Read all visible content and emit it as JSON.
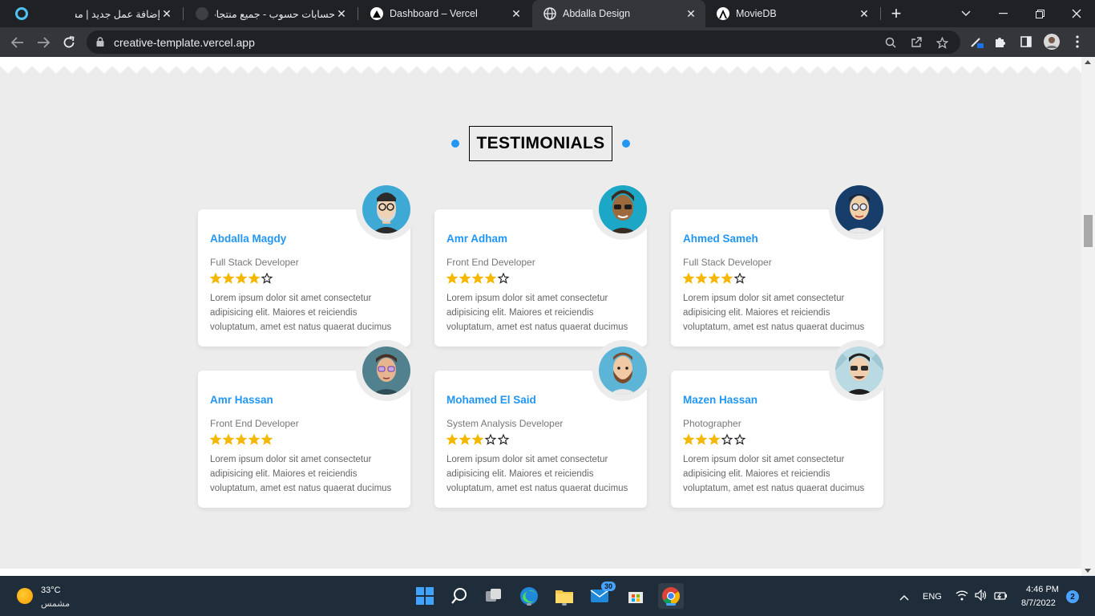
{
  "browser": {
    "tabs": [
      {
        "title": "إضافة عمل جديد | مستقل",
        "icon": "mostaql-icon"
      },
      {
        "title": "حسابات حسوب - جميع منتجات",
        "icon": "hsoub-icon"
      },
      {
        "title": "Dashboard – Vercel",
        "icon": "vercel-icon"
      },
      {
        "title": "Abdalla Design",
        "icon": "globe-icon",
        "active": true
      },
      {
        "title": "MovieDB",
        "icon": "angular-icon"
      }
    ],
    "url": "creative-template.vercel.app"
  },
  "testimonials": {
    "title": "TESTIMONIALS",
    "accent": "#2196f3",
    "star_color": "#f5b800",
    "items": [
      {
        "name": "Abdalla Magdy",
        "role": "Full Stack Developer",
        "rating": 4,
        "text": "Lorem ipsum dolor sit amet consectetur adipisicing elit. Maiores et reiciendis voluptatum, amet est natus quaerat ducimus",
        "avatar": "avatar-glasses-beard"
      },
      {
        "name": "Amr Adham",
        "role": "Front End Developer",
        "rating": 4,
        "text": "Lorem ipsum dolor sit amet consectetur adipisicing elit. Maiores et reiciendis voluptatum, amet est natus quaerat ducimus",
        "avatar": "avatar-sunglasses"
      },
      {
        "name": "Ahmed Sameh",
        "role": "Full Stack Developer",
        "rating": 4,
        "text": "Lorem ipsum dolor sit amet consectetur adipisicing elit. Maiores et reiciendis voluptatum, amet est natus quaerat ducimus",
        "avatar": "avatar-glasses"
      },
      {
        "name": "Amr Hassan",
        "role": "Front End Developer",
        "rating": 5,
        "text": "Lorem ipsum dolor sit amet consectetur adipisicing elit. Maiores et reiciendis voluptatum, amet est natus quaerat ducimus",
        "avatar": "avatar-purple-glasses"
      },
      {
        "name": "Mohamed El Said",
        "role": "System Analysis Developer",
        "rating": 3,
        "text": "Lorem ipsum dolor sit amet consectetur adipisicing elit. Maiores et reiciendis voluptatum, amet est natus quaerat ducimus",
        "avatar": "avatar-beard"
      },
      {
        "name": "Mazen Hassan",
        "role": "Photographer",
        "rating": 3,
        "text": "Lorem ipsum dolor sit amet consectetur adipisicing elit. Maiores et reiciendis voluptatum, amet est natus quaerat ducimus",
        "avatar": "avatar-sunglasses-2"
      }
    ]
  },
  "taskbar": {
    "temperature": "33°C",
    "weather": "مشمس",
    "mail_badge": "30",
    "language": "ENG",
    "time": "4:46 PM",
    "date": "8/7/2022",
    "notifications": "2"
  }
}
